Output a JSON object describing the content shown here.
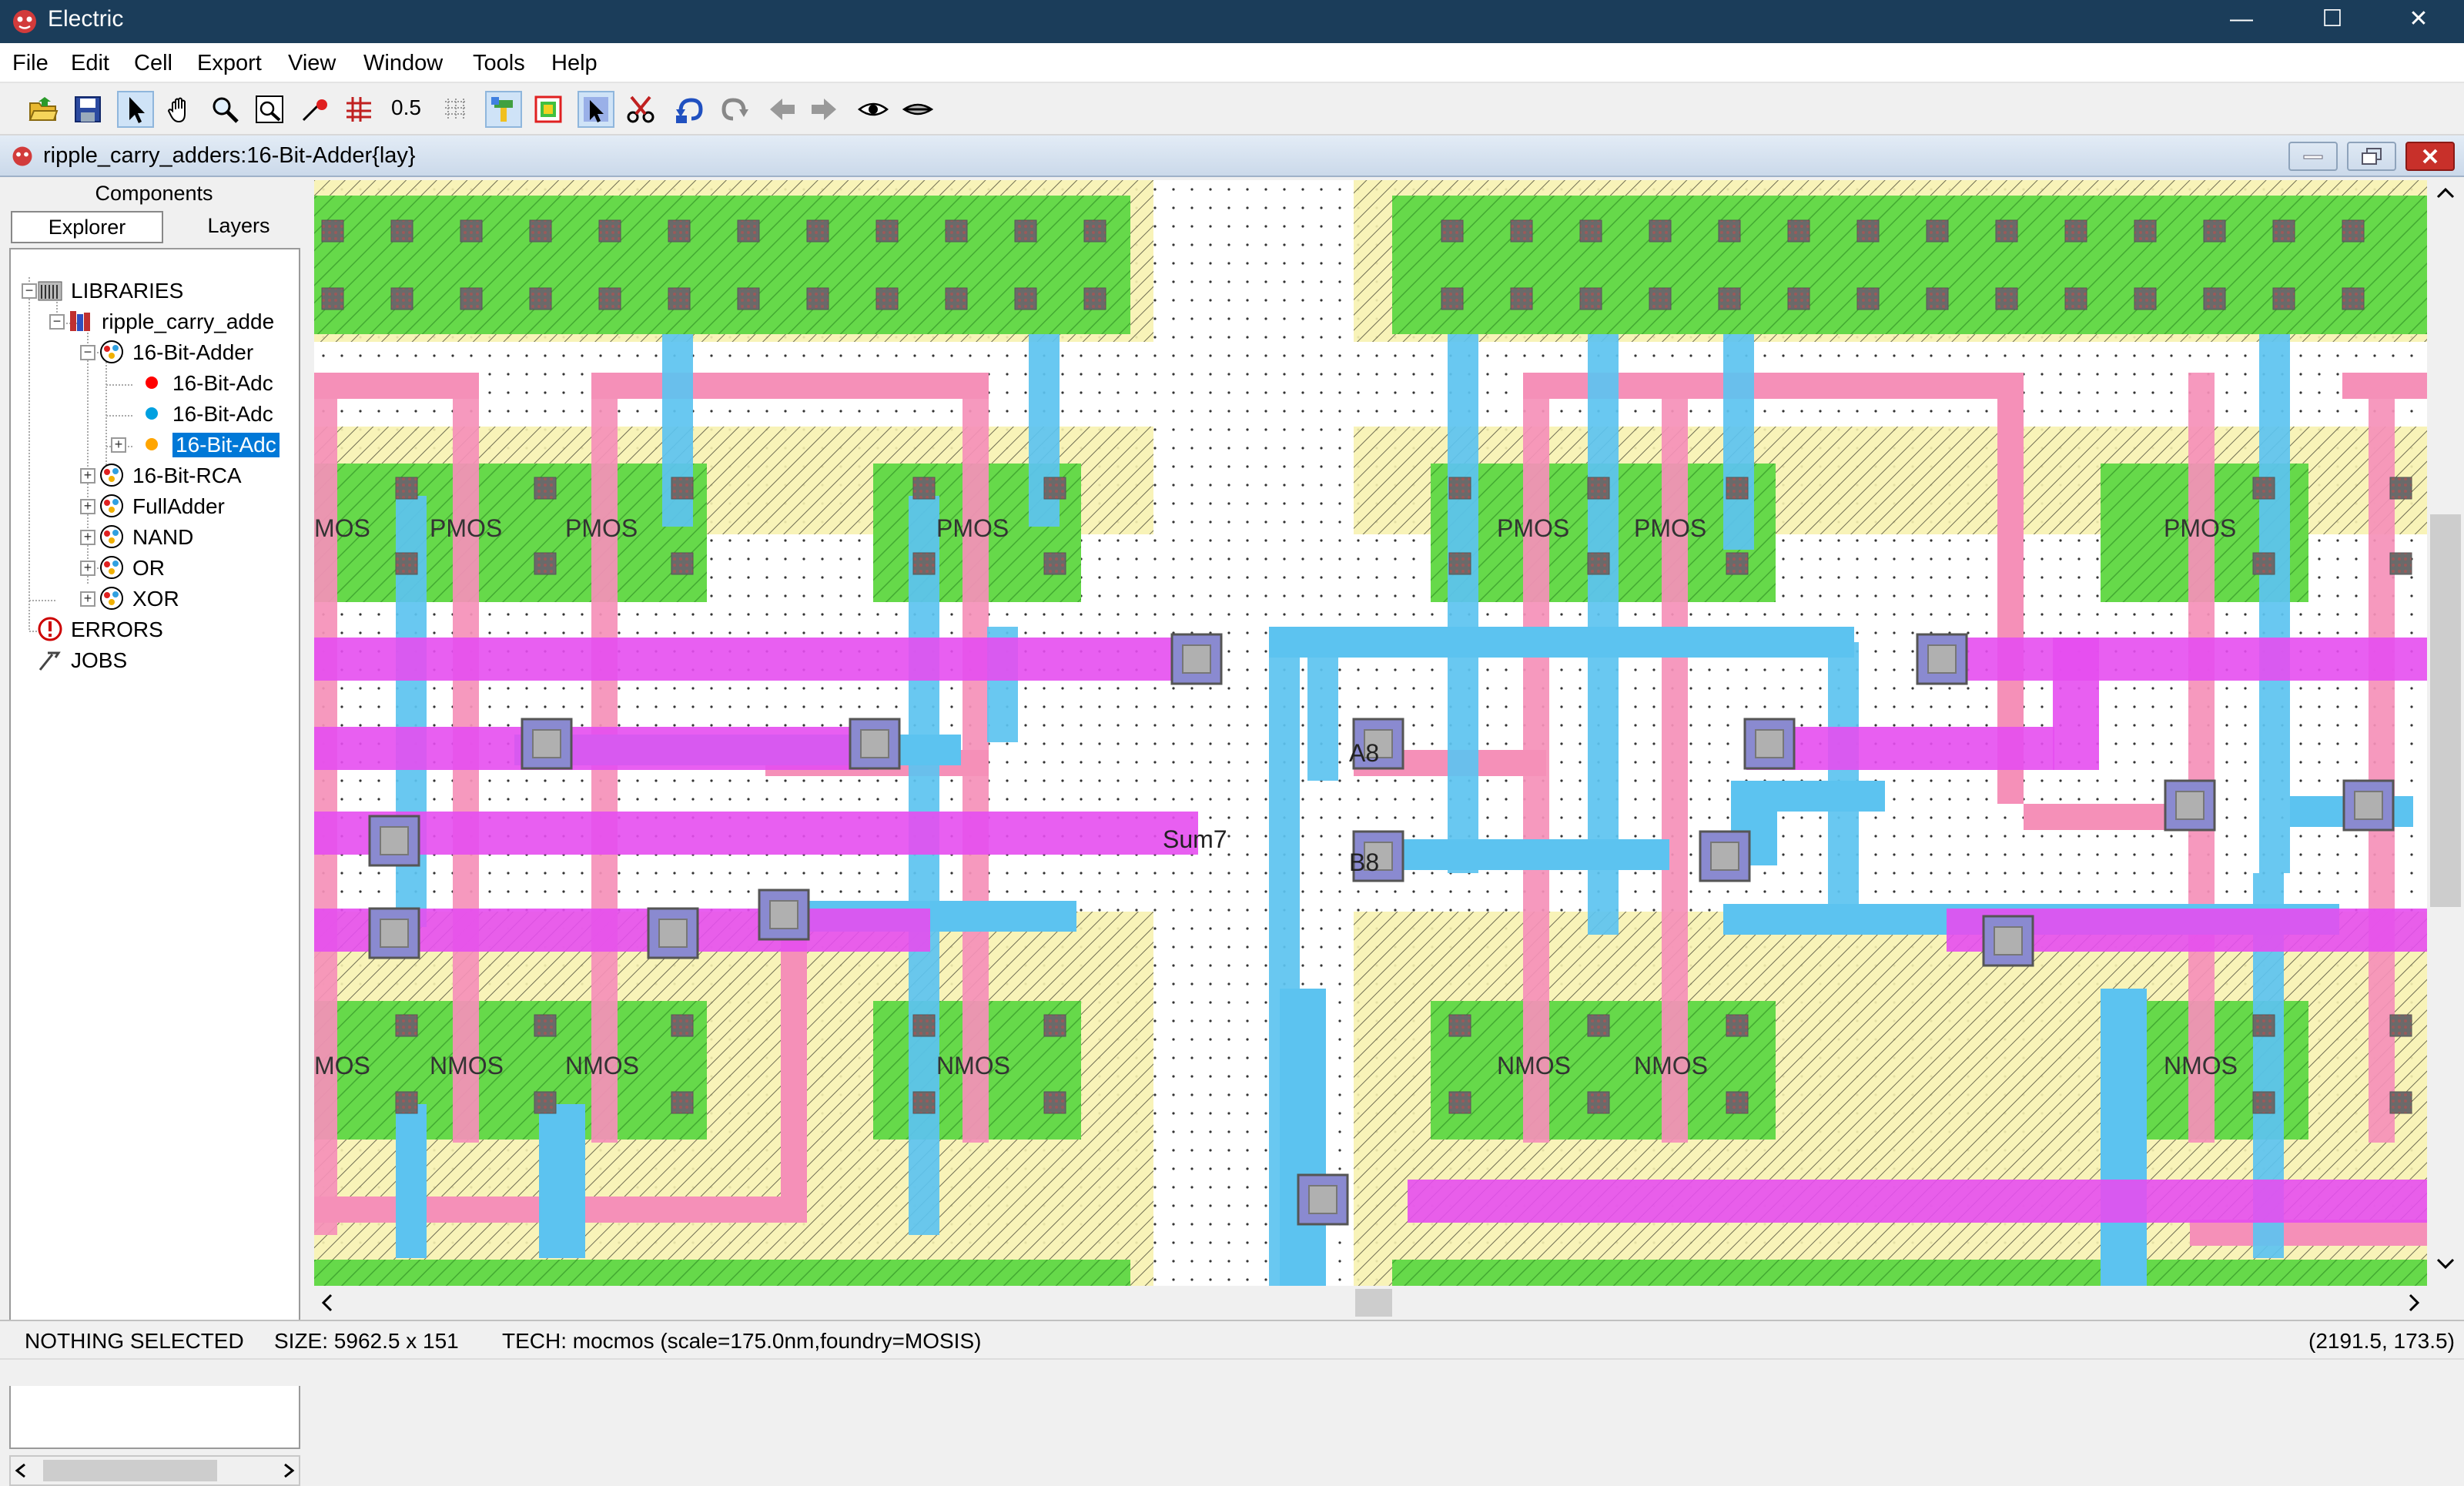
{
  "window": {
    "title": "Electric",
    "minimize": "—",
    "maximize": "☐",
    "close": "✕"
  },
  "menu": [
    "File",
    "Edit",
    "Cell",
    "Export",
    "View",
    "Window",
    "Tools",
    "Help"
  ],
  "toolbar": {
    "grid_value": "0.5",
    "icons": [
      "open-library-icon",
      "save-icon",
      "select-arrow-icon",
      "pan-hand-icon",
      "zoom-icon",
      "zoom-fit-icon",
      "outline-icon",
      "grid-icon",
      "grid-align-icon",
      "measure-icon",
      "place-icon",
      "select-area-icon",
      "special-select-icon",
      "cut-icon",
      "undo-icon",
      "redo-icon",
      "back-arrow-icon",
      "forward-arrow-icon",
      "show-icon",
      "hide-icon"
    ]
  },
  "document": {
    "title": "ripple_carry_adders:16-Bit-Adder{lay}"
  },
  "panel": {
    "top_tab": "Components",
    "tabs": [
      "Explorer",
      "Layers"
    ],
    "active_tab": "Explorer"
  },
  "tree": [
    {
      "label": "LIBRARIES",
      "icon": "libraries-icon",
      "level": 0,
      "expander": "−"
    },
    {
      "label": "ripple_carry_adde",
      "icon": "library-icon",
      "level": 1,
      "expander": "−"
    },
    {
      "label": "16-Bit-Adder",
      "icon": "cell-icon",
      "level": 2,
      "expander": "−"
    },
    {
      "label": "16-Bit-Adc",
      "icon": "red-dot-icon",
      "level": 3,
      "expander": "",
      "color": "#ff0000"
    },
    {
      "label": "16-Bit-Adc",
      "icon": "blue-dot-icon",
      "level": 3,
      "expander": "",
      "color": "#00a0e0"
    },
    {
      "label": "16-Bit-Adc",
      "icon": "orange-dot-icon",
      "level": 3,
      "expander": "+",
      "color": "#ffa500",
      "selected": true
    },
    {
      "label": "16-Bit-RCA",
      "icon": "cell-icon",
      "level": 2,
      "expander": "+"
    },
    {
      "label": "FullAdder",
      "icon": "cell-icon",
      "level": 2,
      "expander": "+"
    },
    {
      "label": "NAND",
      "icon": "cell-icon",
      "level": 2,
      "expander": "+"
    },
    {
      "label": "OR",
      "icon": "cell-icon",
      "level": 2,
      "expander": "+"
    },
    {
      "label": "XOR",
      "icon": "cell-icon",
      "level": 2,
      "expander": "+"
    },
    {
      "label": "ERRORS",
      "icon": "errors-icon",
      "level": 0,
      "expander": ""
    },
    {
      "label": "JOBS",
      "icon": "jobs-icon",
      "level": 0,
      "expander": ""
    }
  ],
  "layout_labels": {
    "pmos": "PMOS",
    "nmos": "NMOS",
    "pmos_clipped": "MOS",
    "nmos_clipped": "MOS",
    "a8": "A8",
    "b8": "B8",
    "sum7": "Sum7"
  },
  "colors": {
    "metal1": "#5cc3f0",
    "metal2": "#e64ef0",
    "poly": "#f590b8",
    "active": "#66d94a",
    "select": "#f7f2b0",
    "contact": "#7a7a7a",
    "via": "#8a8ad0",
    "titlebar": "#1b3d5a",
    "selection": "#0078d7"
  },
  "status": {
    "selection": "NOTHING SELECTED",
    "size": "SIZE: 5962.5 x 151",
    "tech": "TECH: mocmos (scale=175.0nm,foundry=MOSIS)",
    "coords": "(2191.5, 173.5)"
  }
}
